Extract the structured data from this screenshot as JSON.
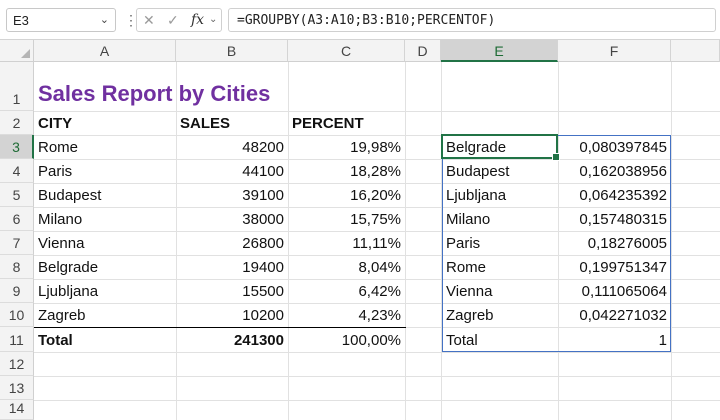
{
  "formula_bar": {
    "name_box": "E3",
    "formula": "=GROUPBY(A3:A10;B3:B10;PERCENTOF)"
  },
  "icons": {
    "cancel": "close-icon",
    "enter": "check-icon",
    "function": "fx-icon"
  },
  "colors": {
    "title": "#7030a0",
    "selection": "#217346",
    "spill_border": "#4472c4"
  },
  "columns": [
    "A",
    "B",
    "C",
    "D",
    "E",
    "F"
  ],
  "rows": [
    "1",
    "2",
    "3",
    "4",
    "5",
    "6",
    "7",
    "8",
    "9",
    "10",
    "11",
    "12",
    "13",
    "14"
  ],
  "sheet": {
    "title": "Sales Report by Cities",
    "headers": {
      "city": "CITY",
      "sales": "SALES",
      "percent": "PERCENT"
    },
    "data": [
      {
        "city": "Rome",
        "sales": "48200",
        "percent": "19,98%"
      },
      {
        "city": "Paris",
        "sales": "44100",
        "percent": "18,28%"
      },
      {
        "city": "Budapest",
        "sales": "39100",
        "percent": "16,20%"
      },
      {
        "city": "Milano",
        "sales": "38000",
        "percent": "15,75%"
      },
      {
        "city": "Vienna",
        "sales": "26800",
        "percent": "11,11%"
      },
      {
        "city": "Belgrade",
        "sales": "19400",
        "percent": "8,04%"
      },
      {
        "city": "Ljubljana",
        "sales": "15500",
        "percent": "6,42%"
      },
      {
        "city": "Zagreb",
        "sales": "10200",
        "percent": "4,23%"
      }
    ],
    "total": {
      "city": "Total",
      "sales": "241300",
      "percent": "100,00%"
    },
    "groupby": [
      {
        "city": "Belgrade",
        "value": "0,080397845"
      },
      {
        "city": "Budapest",
        "value": "0,162038956"
      },
      {
        "city": "Ljubljana",
        "value": "0,064235392"
      },
      {
        "city": "Milano",
        "value": "0,157480315"
      },
      {
        "city": "Paris",
        "value": "0,18276005"
      },
      {
        "city": "Rome",
        "value": "0,199751347"
      },
      {
        "city": "Vienna",
        "value": "0,111065064"
      },
      {
        "city": "Zagreb",
        "value": "0,042271032"
      },
      {
        "city": "Total",
        "value": "1"
      }
    ]
  }
}
